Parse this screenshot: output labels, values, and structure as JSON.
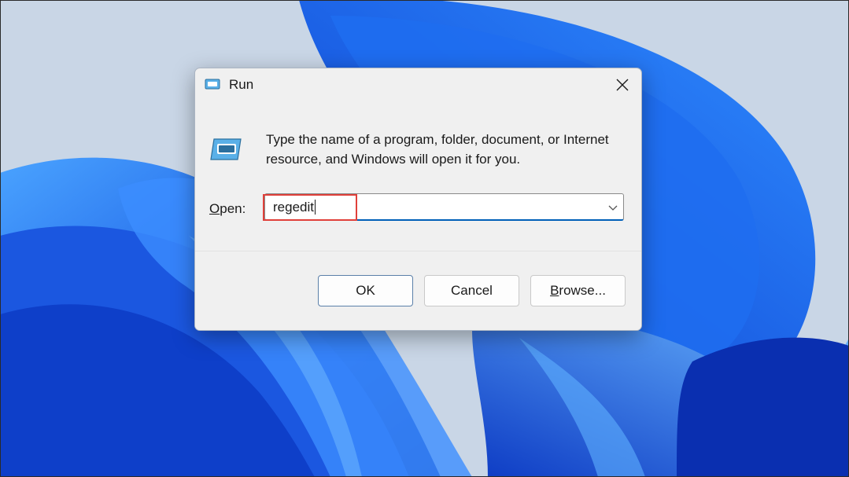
{
  "window": {
    "title": "Run",
    "icon": "run-app-icon",
    "close_icon": "close-icon"
  },
  "content": {
    "icon": "run-app-icon",
    "description": "Type the name of a program, folder, document, or Internet resource, and Windows will open it for you."
  },
  "open_field": {
    "label_underlined": "O",
    "label_rest": "pen:",
    "value": "regedit",
    "dropdown_icon": "chevron-down-icon"
  },
  "buttons": {
    "ok": "OK",
    "cancel": "Cancel",
    "browse_underlined": "B",
    "browse_rest": "rowse..."
  },
  "colors": {
    "wallpaper_bg": "#c9d6e6",
    "accent": "#005fb8",
    "highlight_box": "#e0403a"
  }
}
